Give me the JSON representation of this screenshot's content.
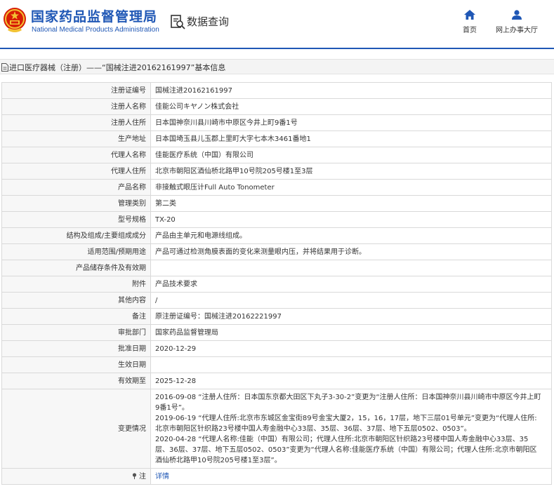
{
  "header": {
    "logo_cn": "国家药品监督管理局",
    "logo_en": "National Medical Products Administration",
    "query_title": "数据查询",
    "nav": {
      "home": "首页",
      "service": "网上办事大厅"
    }
  },
  "section": {
    "title": "进口医疗器械（注册）——“国械注进20162161997”基本信息"
  },
  "rows": [
    {
      "label": "注册证编号",
      "value": "国械注进20162161997"
    },
    {
      "label": "注册人名称",
      "value": "佳能公司キヤノン株式会社"
    },
    {
      "label": "注册人住所",
      "value": "日本国神奈川县川崎市中原区今井上町9番1号"
    },
    {
      "label": "生产地址",
      "value": "日本国埼玉县儿玉郡上里町大字七本木3461番地1"
    },
    {
      "label": "代理人名称",
      "value": "佳能医疗系统（中国）有限公司"
    },
    {
      "label": "代理人住所",
      "value": "北京市朝阳区酒仙桥北路甲10号院205号楼1至3层"
    },
    {
      "label": "产品名称",
      "value": "非接触式眼压计Full Auto Tonometer"
    },
    {
      "label": "管理类别",
      "value": "第二类"
    },
    {
      "label": "型号规格",
      "value": "TX-20"
    },
    {
      "label": "结构及组成/主要组成成分",
      "value": "产品由主单元和电源线组成。"
    },
    {
      "label": "适用范围/预期用途",
      "value": "产品可通过检测角膜表面的变化来测量眼内压，并将结果用于诊断。"
    },
    {
      "label": "产品储存条件及有效期",
      "value": ""
    },
    {
      "label": "附件",
      "value": "产品技术要求"
    },
    {
      "label": "其他内容",
      "value": "/"
    },
    {
      "label": "备注",
      "value": "原注册证编号：国械注进20162221997"
    },
    {
      "label": "审批部门",
      "value": "国家药品监督管理局"
    },
    {
      "label": "批准日期",
      "value": "2020-12-29"
    },
    {
      "label": "生效日期",
      "value": ""
    },
    {
      "label": "有效期至",
      "value": "2025-12-28"
    }
  ],
  "changes": {
    "label": "变更情况",
    "entries": [
      "2016-09-08 “注册人住所：日本国东京都大田区下丸子3-30-2”变更为“注册人住所：日本国神奈川县川崎市中原区今井上町9番1号”。",
      "2019-06-19 “代理人住所:北京市东城区金宝街89号金宝大厦2，15，16，17层，地下三层01号单元”变更为“代理人住所:北京市朝阳区针织路23号楼中国人寿金融中心33层、35层、36层、37层、地下五层0502、0503”。",
      "2020-04-28 “代理人名称:佳能（中国）有限公司；代理人住所:北京市朝阳区针织路23号楼中国人寿金融中心33层、35层、36层、37层、地下五层0502、0503”变更为“代理人名称:佳能医疗系统（中国）有限公司；代理人住所:北京市朝阳区酒仙桥北路甲10号院205号楼1至3层”。"
    ]
  },
  "note": {
    "label": "注",
    "link": "详情"
  },
  "colors": {
    "brand_blue": "#1f57b5",
    "emblem_red": "#d81e06",
    "emblem_gold": "#f3c233"
  },
  "icons": [
    "national-emblem-icon",
    "search-document-icon",
    "home-icon",
    "user-icon",
    "document-icon",
    "pin-icon"
  ]
}
